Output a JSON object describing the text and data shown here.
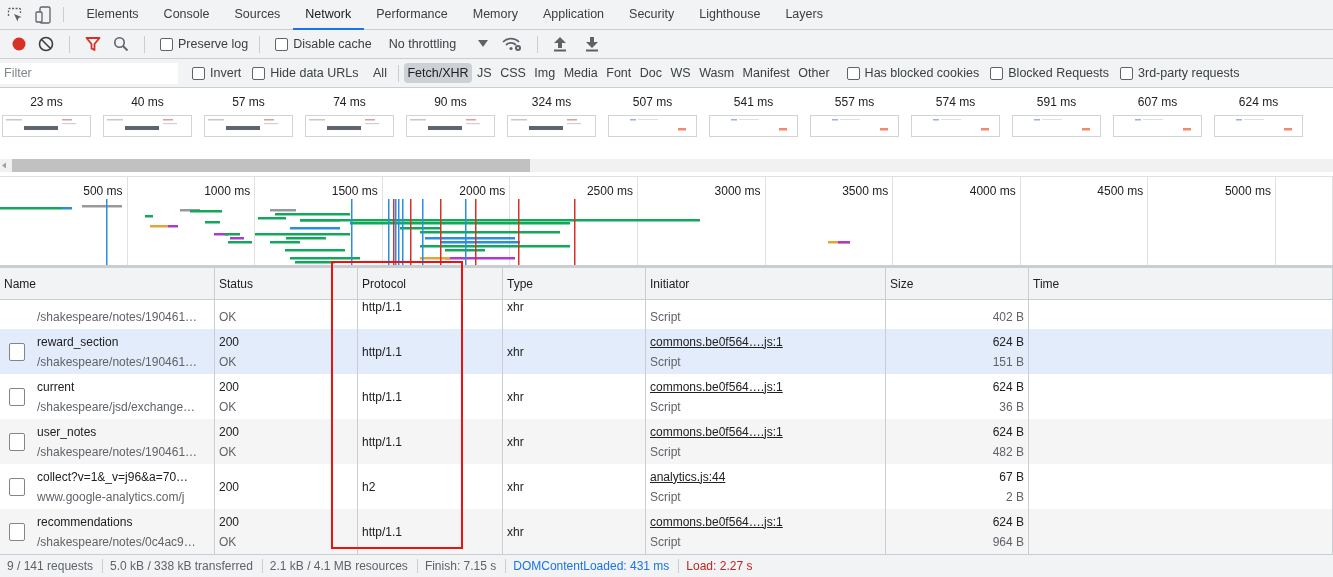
{
  "tabs": [
    {
      "label": "Elements",
      "selected": false
    },
    {
      "label": "Console",
      "selected": false
    },
    {
      "label": "Sources",
      "selected": false
    },
    {
      "label": "Network",
      "selected": true
    },
    {
      "label": "Performance",
      "selected": false
    },
    {
      "label": "Memory",
      "selected": false
    },
    {
      "label": "Application",
      "selected": false
    },
    {
      "label": "Security",
      "selected": false
    },
    {
      "label": "Lighthouse",
      "selected": false
    },
    {
      "label": "Layers",
      "selected": false
    }
  ],
  "toolbar": {
    "recording": true,
    "filter_active": true,
    "preserve_log": {
      "label": "Preserve log",
      "checked": false
    },
    "disable_cache": {
      "label": "Disable cache",
      "checked": false
    },
    "throttling": "No throttling"
  },
  "filter_bar": {
    "placeholder": "Filter",
    "invert": {
      "label": "Invert",
      "checked": false
    },
    "hide_data_urls": {
      "label": "Hide data URLs",
      "checked": false
    },
    "types": [
      {
        "label": "All",
        "selected": false
      },
      {
        "label": "Fetch/XHR",
        "selected": true
      },
      {
        "label": "JS",
        "selected": false
      },
      {
        "label": "CSS",
        "selected": false
      },
      {
        "label": "Img",
        "selected": false
      },
      {
        "label": "Media",
        "selected": false
      },
      {
        "label": "Font",
        "selected": false
      },
      {
        "label": "Doc",
        "selected": false
      },
      {
        "label": "WS",
        "selected": false
      },
      {
        "label": "Wasm",
        "selected": false
      },
      {
        "label": "Manifest",
        "selected": false
      },
      {
        "label": "Other",
        "selected": false
      }
    ],
    "options": [
      {
        "label": "Has blocked cookies",
        "checked": false
      },
      {
        "label": "Blocked Requests",
        "checked": false
      },
      {
        "label": "3rd-party requests",
        "checked": false
      }
    ]
  },
  "filmstrip": [
    {
      "time": "23 ms",
      "kind": "loading"
    },
    {
      "time": "40 ms",
      "kind": "loading"
    },
    {
      "time": "57 ms",
      "kind": "loading"
    },
    {
      "time": "74 ms",
      "kind": "loading"
    },
    {
      "time": "90 ms",
      "kind": "loading"
    },
    {
      "time": "324 ms",
      "kind": "loading"
    },
    {
      "time": "507 ms",
      "kind": "page"
    },
    {
      "time": "541 ms",
      "kind": "page"
    },
    {
      "time": "557 ms",
      "kind": "page"
    },
    {
      "time": "574 ms",
      "kind": "page"
    },
    {
      "time": "591 ms",
      "kind": "page"
    },
    {
      "time": "607 ms",
      "kind": "page"
    },
    {
      "time": "624 ms",
      "kind": "page"
    }
  ],
  "overview": {
    "ticks": [
      "500 ms",
      "1000 ms",
      "1500 ms",
      "2000 ms",
      "2500 ms",
      "3000 ms",
      "3500 ms",
      "4000 ms",
      "4500 ms",
      "5000 ms"
    ]
  },
  "table": {
    "columns": [
      "Name",
      "Status",
      "Protocol",
      "Type",
      "Initiator",
      "Size",
      "Time"
    ],
    "rows": [
      {
        "kind": "partial",
        "path": "/shakespeare/notes/190461…",
        "status_text": "OK",
        "protocol": "http/1.1",
        "type": "xhr",
        "initiator_type": "Script",
        "resource_size": "402 B",
        "selected": false
      },
      {
        "kind": "full",
        "name": "reward_section",
        "path": "/shakespeare/notes/190461…",
        "status": "200",
        "status_text": "OK",
        "protocol": "http/1.1",
        "type": "xhr",
        "initiator": "commons.be0f564….js:1",
        "initiator_type": "Script",
        "size": "624 B",
        "resource_size": "151 B",
        "selected": true
      },
      {
        "kind": "full",
        "name": "current",
        "path": "/shakespeare/jsd/exchange…",
        "status": "200",
        "status_text": "OK",
        "protocol": "http/1.1",
        "type": "xhr",
        "initiator": "commons.be0f564….js:1",
        "initiator_type": "Script",
        "size": "624 B",
        "resource_size": "36 B",
        "selected": false
      },
      {
        "kind": "full",
        "name": "user_notes",
        "path": "/shakespeare/notes/190461…",
        "status": "200",
        "status_text": "OK",
        "protocol": "http/1.1",
        "type": "xhr",
        "initiator": "commons.be0f564….js:1",
        "initiator_type": "Script",
        "size": "624 B",
        "resource_size": "482 B",
        "selected": false
      },
      {
        "kind": "full",
        "name": "collect?v=1&_v=j96&a=70…",
        "path": "www.google-analytics.com/j",
        "status": "200",
        "protocol": "h2",
        "type": "xhr",
        "initiator": "analytics.js:44",
        "initiator_type": "Script",
        "size": "67 B",
        "resource_size": "2 B",
        "selected": false
      },
      {
        "kind": "full",
        "name": "recommendations",
        "path": "/shakespeare/notes/0c4ac9…",
        "status": "200",
        "status_text": "OK",
        "protocol": "http/1.1",
        "type": "xhr",
        "initiator": "commons.be0f564….js:1",
        "initiator_type": "Script",
        "size": "624 B",
        "resource_size": "964 B",
        "selected": false
      }
    ]
  },
  "annotation": {
    "kind": "rectangle"
  },
  "status_bar": [
    {
      "text": "9 / 141 requests",
      "kind": "plain"
    },
    {
      "text": "5.0 kB / 338 kB transferred",
      "kind": "plain"
    },
    {
      "text": "2.1 kB / 4.1 MB resources",
      "kind": "plain"
    },
    {
      "text": "Finish: 7.15 s",
      "kind": "plain"
    },
    {
      "text": "DOMContentLoaded: 431 ms",
      "kind": "dom_content_loaded"
    },
    {
      "text": "Load: 2.27 s",
      "kind": "load"
    }
  ]
}
